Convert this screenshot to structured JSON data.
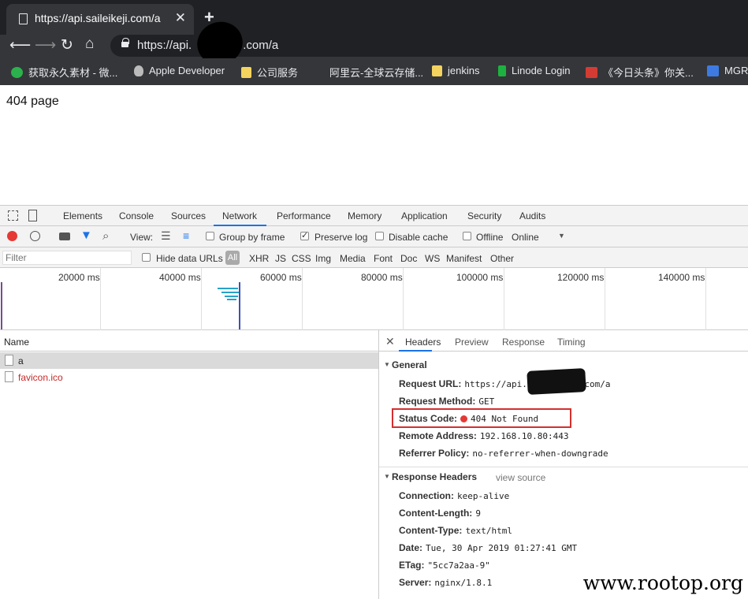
{
  "browser": {
    "tab_title": "https://api.saileikeji.com/a",
    "url_prefix": "https://api.",
    "url_suffix": ".com/a",
    "bookmarks": [
      {
        "label": "获取永久素材 - 微...",
        "icon": "wechat-icon",
        "color": "#2bb24c"
      },
      {
        "label": "Apple Developer",
        "icon": "apple-icon",
        "color": "#bbbbbb"
      },
      {
        "label": "公司服务",
        "icon": "folder-icon",
        "color": "#f4d35e"
      },
      {
        "label": "阿里云-全球云存储...",
        "icon": "aliyun-icon",
        "color": "#35363a"
      },
      {
        "label": "jenkins",
        "icon": "folder-icon",
        "color": "#f4d35e"
      },
      {
        "label": "Linode Login",
        "icon": "linode-icon",
        "color": "#1db23f"
      },
      {
        "label": "《今日头条》你关...",
        "icon": "toutiao-icon",
        "color": "#d43c33"
      },
      {
        "label": "MGR",
        "icon": "pen-icon",
        "color": "#3d7be3"
      }
    ]
  },
  "page": {
    "text": "404 page"
  },
  "devtools": {
    "tabs": [
      "Elements",
      "Console",
      "Sources",
      "Network",
      "Performance",
      "Memory",
      "Application",
      "Security",
      "Audits"
    ],
    "active_tab": "Network",
    "toolbar": {
      "view_label": "View:",
      "group_by_frame": "Group by frame",
      "preserve_log": "Preserve log",
      "disable_cache": "Disable cache",
      "offline": "Offline",
      "throttle": "Online"
    },
    "filter": {
      "placeholder": "Filter",
      "hide_data_urls": "Hide data URLs",
      "types": [
        "All",
        "XHR",
        "JS",
        "CSS",
        "Img",
        "Media",
        "Font",
        "Doc",
        "WS",
        "Manifest",
        "Other"
      ]
    },
    "timeline_ticks": [
      "20000 ms",
      "40000 ms",
      "60000 ms",
      "80000 ms",
      "100000 ms",
      "120000 ms",
      "140000 ms"
    ],
    "requests": {
      "header": "Name",
      "rows": [
        {
          "name": "a",
          "selected": true,
          "error": false
        },
        {
          "name": "favicon.ico",
          "selected": false,
          "error": true
        }
      ]
    },
    "detail_tabs": [
      "Headers",
      "Preview",
      "Response",
      "Timing"
    ],
    "general": {
      "title": "General",
      "request_url_k": "Request URL:",
      "request_url_v1": "https://api.s",
      "request_url_v2": "com/a",
      "method_k": "Request Method:",
      "method_v": "GET",
      "status_k": "Status Code:",
      "status_v": "404 Not Found",
      "remote_k": "Remote Address:",
      "remote_v": "192.168.10.80:443",
      "referrer_k": "Referrer Policy:",
      "referrer_v": "no-referrer-when-downgrade"
    },
    "response_headers": {
      "title": "Response Headers",
      "view_source": "view source",
      "items": [
        {
          "k": "Connection:",
          "v": "keep-alive"
        },
        {
          "k": "Content-Length:",
          "v": "9"
        },
        {
          "k": "Content-Type:",
          "v": "text/html"
        },
        {
          "k": "Date:",
          "v": "Tue, 30 Apr 2019 01:27:41 GMT"
        },
        {
          "k": "ETag:",
          "v": "\"5cc7a2aa-9\""
        },
        {
          "k": "Server:",
          "v": "nginx/1.8.1"
        }
      ]
    }
  },
  "watermark": "www.rootop.org",
  "colors": {
    "accent": "#1a73e8",
    "highlight": "#d32f2f",
    "error_text": "#c62828"
  }
}
